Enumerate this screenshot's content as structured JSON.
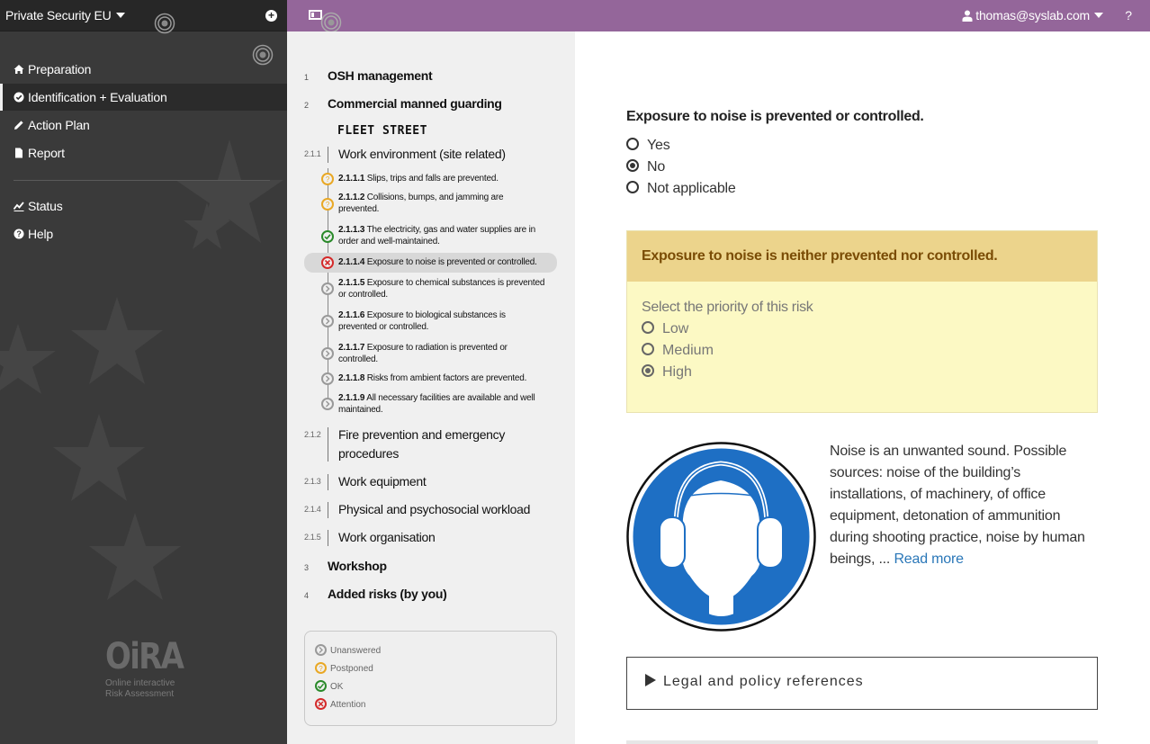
{
  "app": {
    "tool_name": "Private Security EU",
    "user": "thomas@syslab.com",
    "help_label": "?"
  },
  "sidebar": {
    "items": [
      {
        "label": "Preparation",
        "icon": "home-icon"
      },
      {
        "label": "Identification + Evaluation",
        "icon": "check-circle-icon"
      },
      {
        "label": "Action Plan",
        "icon": "pencil-icon"
      },
      {
        "label": "Report",
        "icon": "document-icon"
      }
    ],
    "secondary": [
      {
        "label": "Status",
        "icon": "chart-icon"
      },
      {
        "label": "Help",
        "icon": "question-circle-icon"
      }
    ],
    "logo": {
      "name": "OiRA",
      "line1": "Online interactive",
      "line2": "Risk Assessment"
    }
  },
  "tree": {
    "modules": [
      {
        "number": "1",
        "title": "OSH management"
      },
      {
        "number": "2",
        "title": "Commercial manned guarding"
      },
      {
        "number": "3",
        "title": "Workshop"
      },
      {
        "number": "4",
        "title": "Added risks (by you)"
      }
    ],
    "profile_title": "FLEET STREET",
    "submodules": [
      {
        "number": "2.1.1",
        "title": "Work environment (site related)"
      },
      {
        "number": "2.1.2",
        "title": "Fire prevention and emergency procedures"
      },
      {
        "number": "2.1.3",
        "title": "Work equipment"
      },
      {
        "number": "2.1.4",
        "title": "Physical and psychosocial workload"
      },
      {
        "number": "2.1.5",
        "title": "Work organisation"
      }
    ],
    "risks": [
      {
        "number": "2.1.1.1",
        "title": "Slips, trips and falls are prevented.",
        "status": "postponed"
      },
      {
        "number": "2.1.1.2",
        "title": "Collisions, bumps, and jamming are prevented.",
        "status": "postponed"
      },
      {
        "number": "2.1.1.3",
        "title": "The electricity, gas and water supplies are in order and well-maintained.",
        "status": "ok"
      },
      {
        "number": "2.1.1.4",
        "title": "Exposure to noise is prevented or controlled.",
        "status": "attention"
      },
      {
        "number": "2.1.1.5",
        "title": "Exposure to chemical substances is prevented or controlled.",
        "status": "unanswered"
      },
      {
        "number": "2.1.1.6",
        "title": "Exposure to biological substances is prevented or controlled.",
        "status": "unanswered"
      },
      {
        "number": "2.1.1.7",
        "title": "Exposure to radiation is prevented or controlled.",
        "status": "unanswered"
      },
      {
        "number": "2.1.1.8",
        "title": "Risks from ambient factors are prevented.",
        "status": "unanswered"
      },
      {
        "number": "2.1.1.9",
        "title": "All necessary facilities are available and well maintained.",
        "status": "unanswered"
      }
    ],
    "legend": [
      {
        "label": "Unanswered",
        "status": "unanswered"
      },
      {
        "label": "Postponed",
        "status": "postponed"
      },
      {
        "label": "OK",
        "status": "ok"
      },
      {
        "label": "Attention",
        "status": "attention"
      }
    ]
  },
  "main": {
    "question": "Exposure to noise is prevented or controlled.",
    "answers": [
      {
        "label": "Yes",
        "selected": false
      },
      {
        "label": "No",
        "selected": true
      },
      {
        "label": "Not applicable",
        "selected": false
      }
    ],
    "evaluation": {
      "problem": "Exposure to noise is neither prevented nor controlled.",
      "priority_label": "Select the priority of this risk",
      "priorities": [
        {
          "label": "Low",
          "selected": false
        },
        {
          "label": "Medium",
          "selected": false
        },
        {
          "label": "High",
          "selected": true
        }
      ]
    },
    "info_text": "Noise is an unwanted sound.  Possible sources: noise of the building’s installations, of machinery, of office equipment, detonation of ammunition during shooting practice, noise by human beings, ...",
    "read_more": "Read more",
    "legal_title": "Legal and policy references"
  },
  "colors": {
    "topbar": "#94669a",
    "sidebar": "#3a3a3a",
    "eval_header": "#ecd48c",
    "eval_body": "#fcf9c4",
    "link": "#2a77b8",
    "postponed": "#e9a825",
    "ok": "#2a8a2a",
    "attention": "#d42a2a",
    "pictogram_blue": "#1e6fc4"
  }
}
